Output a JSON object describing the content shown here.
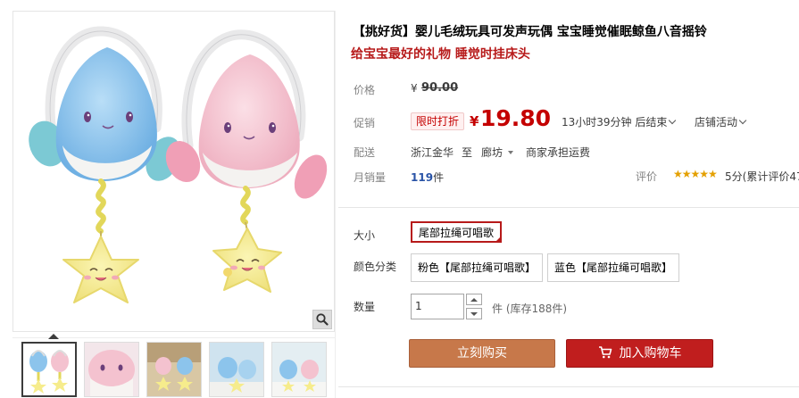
{
  "product": {
    "title": "【挑好货】婴儿毛绒玩具可发声玩偶 宝宝睡觉催眠鲸鱼八音摇铃",
    "subtitle": "给宝宝最好的礼物 睡觉时挂床头"
  },
  "price": {
    "label": "价格",
    "currency": "¥",
    "original": "90.00",
    "promo_label": "促销",
    "promo_tag": "限时打折",
    "current": "19.80",
    "countdown": "13小时39分钟 后结束",
    "activity": "店铺活动"
  },
  "shipping": {
    "label": "配送",
    "origin": "浙江金华",
    "to": "至",
    "destination": "廊坊",
    "fee": "商家承担运费"
  },
  "sales": {
    "label": "月销量",
    "count": "119",
    "unit": "件",
    "review_label": "评价",
    "stars": "★★★★★",
    "score": "5分(累计评价47"
  },
  "sku": {
    "size_label": "大小",
    "size_selected": "尾部拉绳可唱歌",
    "color_label": "颜色分类",
    "colors": [
      "粉色【尾部拉绳可唱歌】",
      "蓝色【尾部拉绳可唱歌】"
    ]
  },
  "quantity": {
    "label": "数量",
    "value": "1",
    "unit": "件",
    "stock": "(库存188件)"
  },
  "actions": {
    "buy_now": "立刻购买",
    "add_to_cart": "加入购物车"
  },
  "icons": {
    "zoom": "magnifier-icon",
    "cart": "shopping-cart-icon"
  },
  "colors": {
    "brand_red": "#c40000",
    "buy_button": "#c7784a",
    "cart_button": "#c01e1e",
    "toy_blue": "#8cc4ec",
    "toy_pink": "#f4c2cf",
    "star_yellow": "#f6ec8c"
  }
}
